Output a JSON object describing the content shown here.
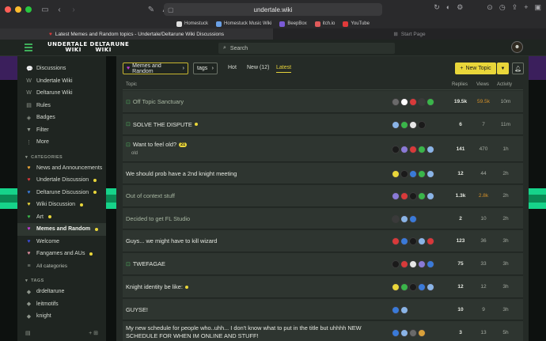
{
  "browser": {
    "url": "undertale.wiki",
    "bookmarks": [
      {
        "label": "Homestuck",
        "color": "#e0e0e0"
      },
      {
        "label": "Homestuck Music Wiki",
        "color": "#6aa0e6"
      },
      {
        "label": "BeepBox",
        "color": "#7a5ad6"
      },
      {
        "label": "itch.io",
        "color": "#e05a5a"
      },
      {
        "label": "YouTube",
        "color": "#e03a3a"
      }
    ],
    "tabs": [
      {
        "label": "Latest Memes and Random topics - Undertale/Deltarune Wiki Discussions"
      },
      {
        "label": "Start Page"
      }
    ]
  },
  "header": {
    "logo_line1": "UNDERTALE DELTARUNE",
    "logo_line2": "WIKI      WIKI",
    "search_placeholder": "Search"
  },
  "sidebar": {
    "main_items": [
      {
        "label": "Discussions",
        "icon": "discussions-icon",
        "glyph": "💬"
      },
      {
        "label": "Undertale Wiki",
        "icon": "wiki-icon",
        "glyph": "W"
      },
      {
        "label": "Deltarune Wiki",
        "icon": "wiki-icon",
        "glyph": "W"
      },
      {
        "label": "Rules",
        "icon": "rules-icon",
        "glyph": "▤"
      },
      {
        "label": "Badges",
        "icon": "badge-icon",
        "glyph": "◈"
      },
      {
        "label": "Filter",
        "icon": "filter-icon",
        "glyph": "▼"
      },
      {
        "label": "More",
        "icon": "more-icon",
        "glyph": "⋮"
      }
    ],
    "categories_heading": "CATEGORIES",
    "categories": [
      {
        "label": "News and Announcements",
        "color": "#e9a53a",
        "dot": false
      },
      {
        "label": "Undertale Discussion",
        "color": "#d8383a",
        "dot": true
      },
      {
        "label": "Deltarune Discussion",
        "color": "#3a7ad8",
        "dot": true
      },
      {
        "label": "Wiki Discussion",
        "color": "#e9d63a",
        "dot": true
      },
      {
        "label": "Art",
        "color": "#3ab54a",
        "dot": true
      },
      {
        "label": "Memes and Random",
        "color": "#c23ad8",
        "dot": true,
        "active": true
      },
      {
        "label": "Welcome",
        "color": "#3a4ad8",
        "dot": false
      },
      {
        "label": "Fangames and AUs",
        "color": "#d88a9a",
        "dot": true
      }
    ],
    "all_categories_label": "All categories",
    "tags_heading": "TAGS",
    "tags": [
      {
        "label": "drdeltarune"
      },
      {
        "label": "leitmotifs"
      },
      {
        "label": "knight"
      }
    ]
  },
  "toolbar": {
    "category_chip": "Memes and Random",
    "tags_chip": "tags",
    "nav": {
      "hot": "Hot",
      "new": "New (12)",
      "latest": "Latest"
    },
    "new_topic": "New Topic"
  },
  "table": {
    "headers": {
      "topic": "Topic",
      "replies": "Replies",
      "views": "Views",
      "activity": "Activity"
    },
    "rows": [
      {
        "title": "Off Topic Sanctuary",
        "pinned": true,
        "visited": true,
        "dot": false,
        "badge": "",
        "sub": "",
        "replies": "19.5k",
        "views": "59.5k",
        "views_hot": true,
        "activity": "10m",
        "avatars": [
          "#6a6a6a",
          "#ffffff",
          "#d83a3a",
          "#3a3a3a",
          "#3ab54a"
        ]
      },
      {
        "title": "SOLVE THE DISPUTE",
        "pinned": true,
        "visited": false,
        "dot": true,
        "badge": "",
        "sub": "",
        "replies": "6",
        "views": "7",
        "views_hot": false,
        "activity": "11m",
        "avatars": [
          "#8ab4e6",
          "#3ab54a",
          "#e6e6e6",
          "#1a1a1a"
        ]
      },
      {
        "title": "Want to feel old?",
        "pinned": true,
        "visited": false,
        "dot": false,
        "badge": "21",
        "sub": "old",
        "replies": "141",
        "views": "470",
        "views_hot": false,
        "activity": "1h",
        "avatars": [
          "#1a1a1a",
          "#8a7ad6",
          "#d83a3a",
          "#3ab54a",
          "#8ab4e6"
        ]
      },
      {
        "title": "We should prob have a 2nd knight meeting",
        "pinned": false,
        "visited": false,
        "dot": false,
        "badge": "",
        "sub": "",
        "replies": "12",
        "views": "44",
        "views_hot": false,
        "activity": "2h",
        "avatars": [
          "#e9d63a",
          "#1a1a1a",
          "#3a7ad8",
          "#3ab54a",
          "#8ab4e6"
        ]
      },
      {
        "title": "Out of context stuff",
        "pinned": false,
        "visited": true,
        "dot": false,
        "badge": "",
        "sub": "",
        "replies": "1.3k",
        "views": "2.8k",
        "views_hot": true,
        "activity": "2h",
        "avatars": [
          "#8a7ad6",
          "#d83a3a",
          "#1a1a1a",
          "#3ab54a",
          "#8ab4e6"
        ]
      },
      {
        "title": "Decided to get FL Studio",
        "pinned": false,
        "visited": true,
        "dot": false,
        "badge": "",
        "sub": "",
        "replies": "2",
        "views": "10",
        "views_hot": false,
        "activity": "2h",
        "avatars": [
          "#3a3a3a",
          "#8ab4e6",
          "#3a7ad8"
        ]
      },
      {
        "title": "Guys... we might have to kill wizard",
        "pinned": false,
        "visited": false,
        "dot": false,
        "badge": "",
        "sub": "",
        "replies": "123",
        "views": "36",
        "views_hot": false,
        "activity": "3h",
        "avatars": [
          "#d83a3a",
          "#3a7ad8",
          "#1a1a1a",
          "#8ab4e6",
          "#d8383a"
        ]
      },
      {
        "title": "TWEFAGAE",
        "pinned": true,
        "visited": false,
        "dot": false,
        "badge": "",
        "sub": "",
        "replies": "75",
        "views": "33",
        "views_hot": false,
        "activity": "3h",
        "avatars": [
          "#1a1a1a",
          "#d83a3a",
          "#e6e6e6",
          "#8a7ad6",
          "#3a7ad8"
        ]
      },
      {
        "title": "Knight identity be like:",
        "pinned": false,
        "visited": false,
        "dot": true,
        "badge": "",
        "sub": "",
        "replies": "12",
        "views": "12",
        "views_hot": false,
        "activity": "3h",
        "avatars": [
          "#e9d63a",
          "#3ab54a",
          "#1a1a1a",
          "#3a7ad8",
          "#8ab4e6"
        ]
      },
      {
        "title": "GUYSE!",
        "pinned": false,
        "visited": false,
        "dot": false,
        "badge": "",
        "sub": "",
        "replies": "10",
        "views": "9",
        "views_hot": false,
        "activity": "3h",
        "avatars": [
          "#3a7ad8",
          "#8ab4e6"
        ]
      },
      {
        "title": "My new schedule for people who..uhh... I don't know what to put in the title but uhhhh NEW SCHEDULE FOR WHEN IM ONLINE AND STUFF!",
        "pinned": false,
        "visited": false,
        "dot": false,
        "badge": "",
        "sub": "",
        "replies": "3",
        "views": "13",
        "views_hot": false,
        "activity": "5h",
        "avatars": [
          "#3a7ad8",
          "#8ab4e6",
          "#6a6a6a",
          "#d8a03a"
        ]
      }
    ]
  }
}
